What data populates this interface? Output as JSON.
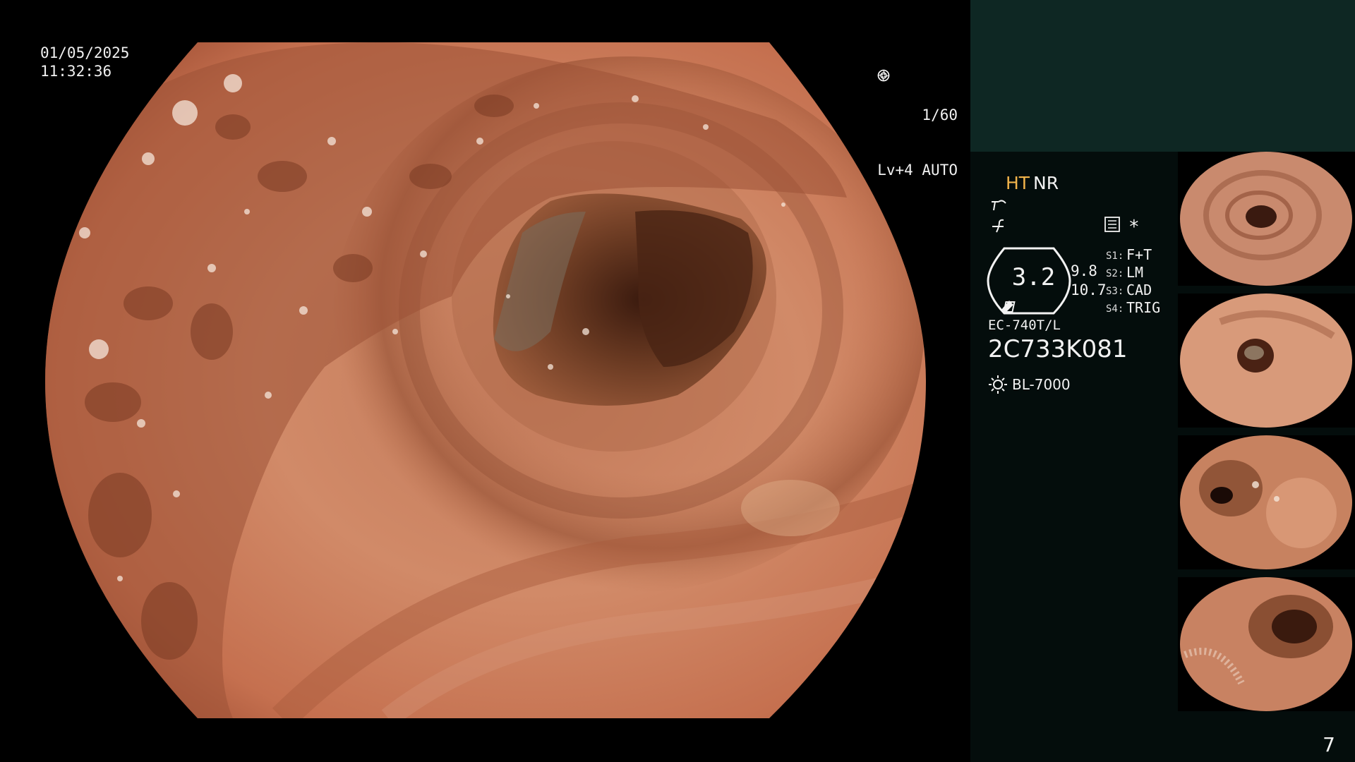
{
  "view": {
    "date": "01/05/2025",
    "time": "11:32:36",
    "shutter": "1/60",
    "level": "Lv+4 AUTO"
  },
  "panel": {
    "mode_ht": "HT",
    "mode_nr": "NR",
    "asterisk": "*",
    "gauge_value": "3.2",
    "value_a": "9.8",
    "value_b": "10.7",
    "switches": [
      {
        "label": "S1:",
        "value": "F+T"
      },
      {
        "label": "S2:",
        "value": "LM"
      },
      {
        "label": "S3:",
        "value": "CAD"
      },
      {
        "label": "S4:",
        "value": "TRIG"
      }
    ],
    "scope_model": "EC-740T/L",
    "scope_serial": "2C733K081",
    "light_source": "BL-7000",
    "page_number": "7"
  },
  "icons": {
    "shutter": "aperture-icon",
    "auto": "iris-icon",
    "a": "brightness-curve-icon",
    "b": "contrast-icon",
    "menu": "memory-icon",
    "light": "sun-icon"
  },
  "colors": {
    "panel_top": "#0e2723",
    "panel_bg": "#040d0c",
    "mode_accent": "#f2b44b",
    "mucosa": "#c9785a"
  }
}
